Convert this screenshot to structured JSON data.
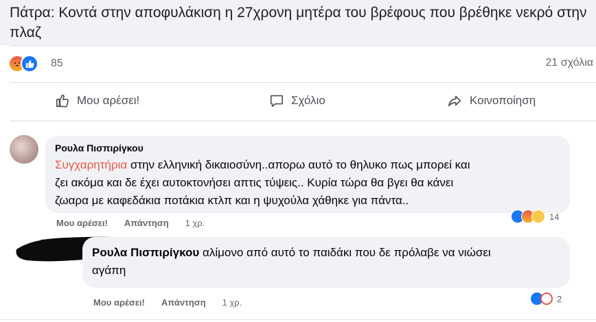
{
  "post": {
    "title": "Πάτρα: Κοντά στην αποφυλάκιση η 27χρονη μητέρα του βρέφους που βρέθηκε νεκρό στην πλαζ",
    "reaction_count": "85",
    "comment_count": "21 σχόλια",
    "reaction_icons": [
      "angry-icon",
      "like-icon"
    ]
  },
  "actions": {
    "like": "Μου αρέσει!",
    "comment": "Σχόλιο",
    "share": "Κοινοποίηση"
  },
  "comments": [
    {
      "author": "Ρουλα Πισπιρίγκου",
      "highlight": "Συγχαρητήρια",
      "line1": " στην ελληνική δικαιοσύνη..απορω αυτό το θηλυκο πως μπορεί και",
      "line2": "ζει ακόμα και δε έχει αυτοκτονήσει απτις τύψεις.. Κυρία τώρα θα βγει θα κάνει",
      "line3": "ζωαρα με καφεδάκια ποτάκια κτλπ και η ψυχούλα χάθηκε για πάντα..",
      "like": "Μου αρέσει!",
      "reply": "Απάντηση",
      "time": "1 χρ.",
      "reaction_count": "14",
      "reaction_icons": [
        "like-icon",
        "angry-icon",
        "sad-icon"
      ]
    },
    {
      "mention": "Ρουλα Πισπιρίγκου",
      "line1": " αλίμονο από αυτό το παιδάκι που δε πρόλαβε να νιώσει",
      "line2": "αγάπη",
      "like": "Μου αρέσει!",
      "reply": "Απάντηση",
      "time": "1 χρ.",
      "reaction_count": "2",
      "reaction_icons": [
        "like-icon",
        "haha-icon"
      ]
    }
  ],
  "colors": {
    "mention_highlight": "#e4594a",
    "like_blue": "#1877f2",
    "bubble": "#f0f2f5",
    "muted_text": "#65676b"
  }
}
